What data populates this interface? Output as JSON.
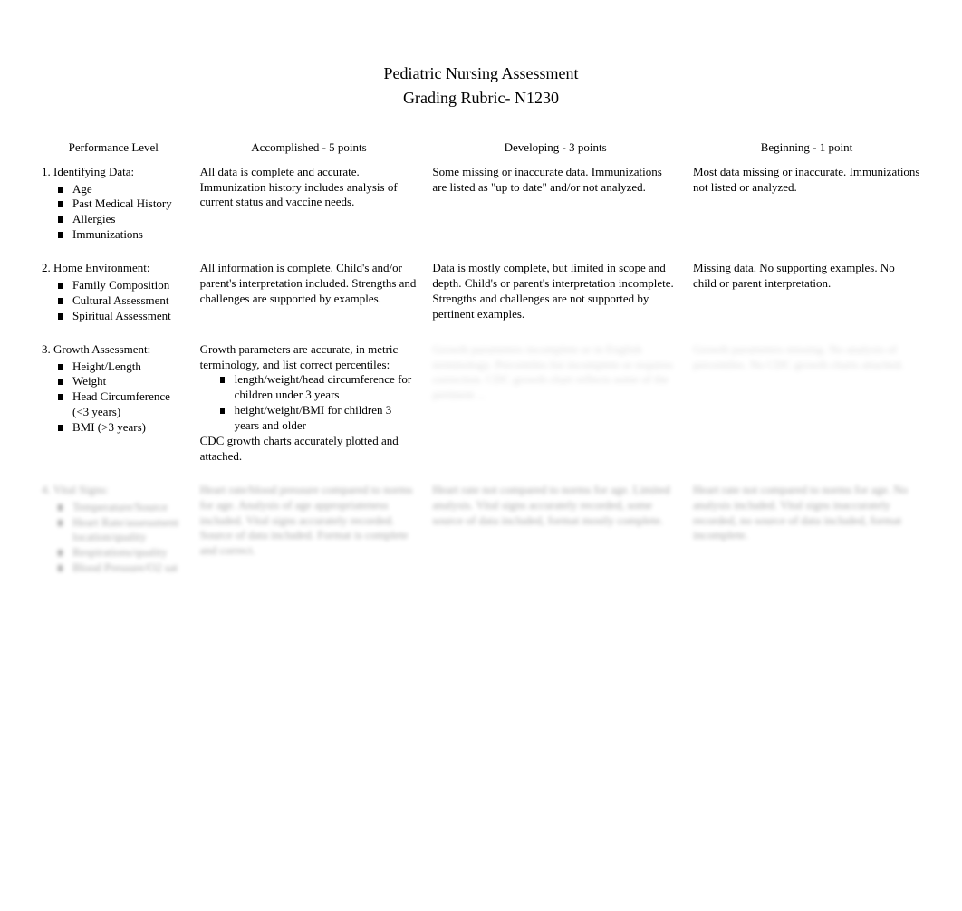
{
  "title": {
    "line1": "Pediatric Nursing Assessment",
    "line2": "Grading Rubric- N1230"
  },
  "headers": {
    "perf": "Performance Level",
    "acc": "Accomplished - 5 points",
    "dev": "Developing - 3 points",
    "beg": "Beginning - 1 point"
  },
  "rows": [
    {
      "criteria_title": "1. Identifying Data:",
      "criteria_items": [
        "Age",
        "Past Medical History",
        "Allergies",
        "Immunizations"
      ],
      "acc": "All data is complete and accurate. Immunization history includes analysis of current status and vaccine needs.",
      "dev": "Some missing or inaccurate data. Immunizations are listed as \"up to date\" and/or not analyzed.",
      "beg": "Most data missing or inaccurate. Immunizations not listed or analyzed."
    },
    {
      "criteria_title": "2. Home Environment:",
      "criteria_items": [
        "Family Composition",
        "Cultural Assessment",
        "Spiritual Assessment"
      ],
      "acc": "All information is complete. Child's and/or parent's interpretation included. Strengths and challenges are supported by examples.",
      "dev": "Data is mostly complete, but limited in scope and depth. Child's or parent's interpretation incomplete. Strengths and challenges are not supported by pertinent examples.",
      "beg": "Missing data. No supporting examples. No child or parent interpretation."
    },
    {
      "criteria_title": "3. Growth Assessment:",
      "criteria_items": [
        "Height/Length",
        "Weight",
        "Head Circumference (<3 years)",
        "BMI (>3 years)"
      ],
      "acc_pre": "Growth parameters are accurate, in metric terminology, and list correct percentiles:",
      "acc_sub": [
        "length/weight/head circumference for children under 3 years",
        "height/weight/BMI for children 3 years and older"
      ],
      "acc_post": "CDC growth charts accurately plotted and attached.",
      "dev": "Growth parameters incomplete or in English terminology. Percentiles list incomplete or requires correction. CDC growth chart reflects some of the pertinent ...",
      "beg": "Growth parameters missing. No analysis of percentiles. No CDC growth charts attached.",
      "dev_blur": true,
      "beg_blur": true
    },
    {
      "criteria_title": "4. Vital Signs:",
      "criteria_items": [
        "Temperature/Source",
        "Heart Rate/assessment location/quality",
        "Respirations/quality",
        "Blood Pressure/O2 sat"
      ],
      "acc": "Heart rate/blood pressure compared to norms for age. Analysis of age appropriateness included. Vital signs accurately recorded. Source of data included. Format is complete and correct.",
      "dev": "Heart rate not compared to norms for age. Limited analysis. Vital signs accurately recorded, some source of data included, format mostly complete.",
      "beg": "Heart rate not compared to norms for age. No analysis included. Vital signs inaccurately recorded, no source of data included, format incomplete.",
      "all_blur": true
    }
  ]
}
